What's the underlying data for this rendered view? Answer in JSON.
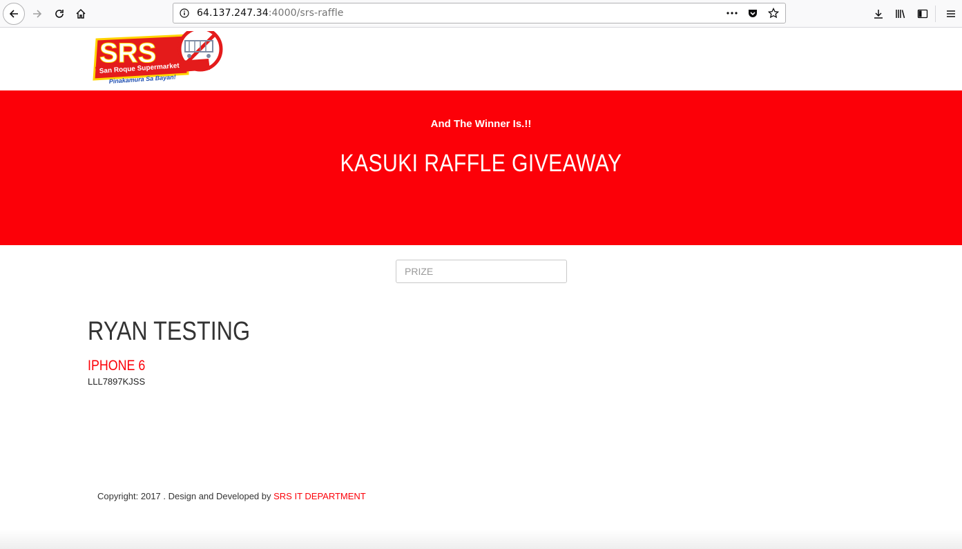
{
  "browser": {
    "url_host": "64.137.247.34",
    "url_path": ":4000/srs-raffle",
    "icons": {
      "back": "back-arrow-icon",
      "forward": "forward-arrow-icon",
      "reload": "reload-icon",
      "home": "home-icon",
      "info": "info-icon",
      "more": "more-dots-icon",
      "pocket": "pocket-icon",
      "bookmark": "star-icon",
      "download": "download-icon",
      "library": "library-icon",
      "sidebar": "sidebar-icon",
      "menu": "hamburger-menu-icon"
    }
  },
  "header": {
    "logo": {
      "brand": "SRS",
      "name": "San Roque Supermarket",
      "tagline": "Pinakamura Sa Bayan!"
    }
  },
  "hero": {
    "subtitle": "And The Winner Is.!!",
    "title": "KASUKI RAFFLE GIVEAWAY",
    "background_color": "#fc0008"
  },
  "prize_input": {
    "placeholder": "PRIZE",
    "value": ""
  },
  "winner": {
    "name": "RYAN TESTING",
    "prize": "IPHONE 6",
    "ticket": "LLL7897KJSS"
  },
  "footer": {
    "text": "Copyright: 2017 . Design and Developed by ",
    "link": "SRS IT DEPARTMENT"
  },
  "colors": {
    "accent": "#fc0008",
    "text": "#333333"
  }
}
